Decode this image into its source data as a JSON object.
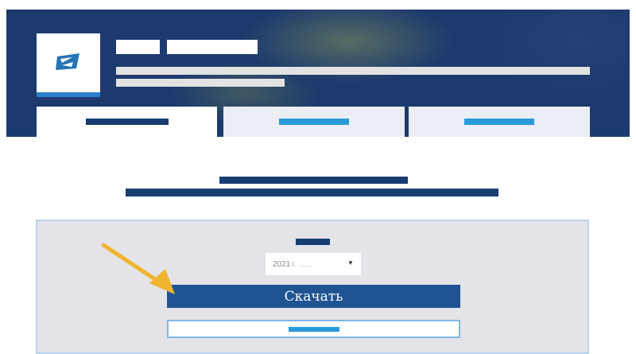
{
  "colors": {
    "header_bg": "#1c3a6e",
    "accent_blue": "#2a9ad8",
    "navy": "#173d73",
    "button_bg": "#1f5493",
    "panel_bg": "#e3e3e8",
    "arrow": "#f1b42f"
  },
  "header": {
    "logo_icon": "flag-logo-icon"
  },
  "tabs": [
    {
      "active": true
    },
    {
      "active": false
    },
    {
      "active": false
    }
  ],
  "form": {
    "year_select": {
      "value": "2021",
      "suffix": "г. ......",
      "caret": "▼"
    },
    "download_label": "Скачать"
  },
  "annotation": {
    "icon": "pointer-arrow-icon"
  }
}
